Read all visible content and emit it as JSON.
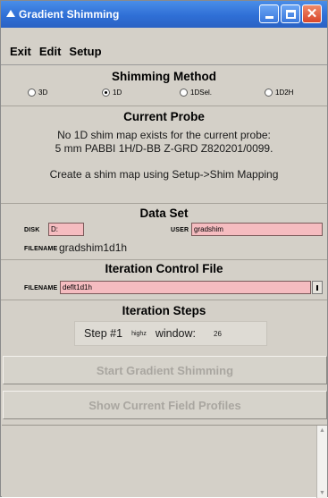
{
  "window": {
    "title": "Gradient Shimming",
    "title_icon": "app-triangle-icon",
    "controls": [
      "minimize-icon",
      "maximize-icon",
      "close-icon"
    ]
  },
  "menu": {
    "items": [
      "Exit",
      "Edit",
      "Setup"
    ]
  },
  "shimming_method": {
    "title": "Shimming Method",
    "options": [
      "3D",
      "1D",
      "1DSel.",
      "1D2H"
    ],
    "selected": "1D"
  },
  "current_probe": {
    "title": "Current Probe",
    "message_line1": "No 1D shim map exists for the current probe:",
    "message_line2": "5 mm PABBI 1H/D-BB Z-GRD Z820201/0099.",
    "hint": "Create a shim map using Setup->Shim Mapping"
  },
  "data_set": {
    "title": "Data Set",
    "disk_label": "DISK",
    "disk_value": "D:",
    "user_label": "USER",
    "user_value": "gradshim",
    "filename_label": "FILENAME",
    "filename_value": "gradshim1d1h"
  },
  "iteration_control_file": {
    "title": "Iteration Control File",
    "filename_label": "FILENAME",
    "filename_value": "deflt1d1h"
  },
  "iteration_steps": {
    "title": "Iteration Steps",
    "step_label": "Step #1",
    "mode": "highz",
    "window_label": "window:",
    "window_value": "26"
  },
  "buttons": {
    "start": "Start Gradient Shimming",
    "profiles": "Show Current Field Profiles"
  },
  "colors": {
    "titlebar": "#2f6fd6",
    "input_pink": "#f5bcc0",
    "panel": "#d4d0c8",
    "disabled_text": "#a9a6a0"
  }
}
